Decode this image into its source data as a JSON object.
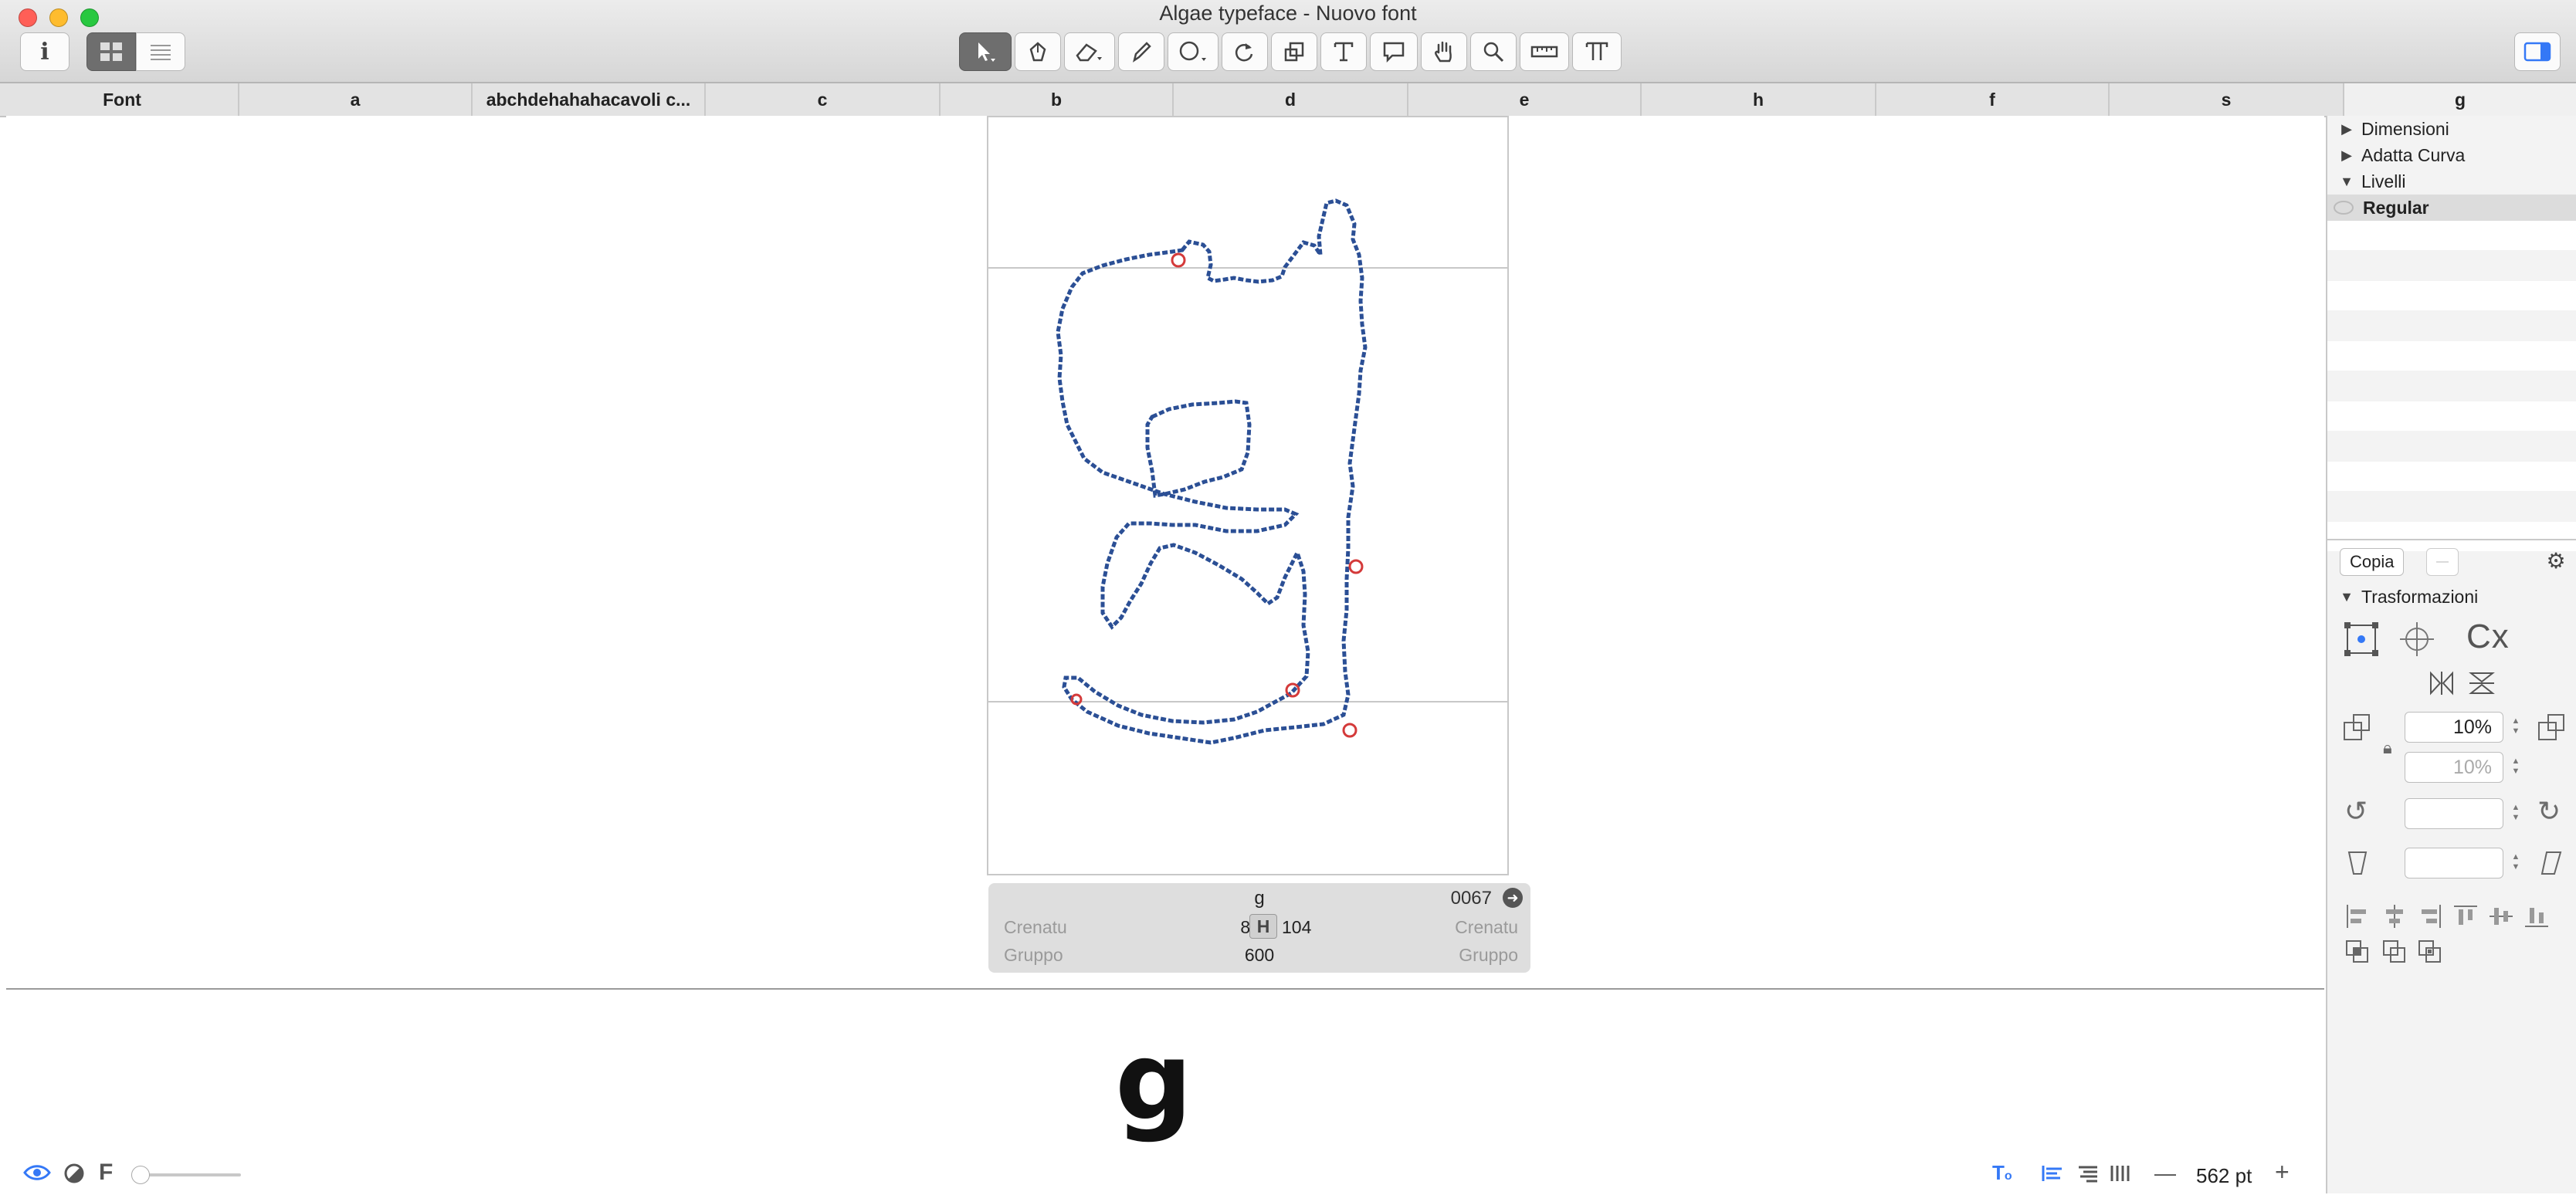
{
  "window": {
    "title": "Algae typeface - Nuovo font"
  },
  "toolbar": {
    "info_icon": "info-icon",
    "tools": [
      "select-tool",
      "pen-tool",
      "eraser-tool",
      "pencil-tool",
      "shape-tool",
      "rotate-tool",
      "scale-tool",
      "text-tool",
      "annotation-tool",
      "hand-tool",
      "zoom-tool",
      "measure-tool",
      "metrics-tool"
    ]
  },
  "tabs": [
    "Font",
    "a",
    "abchdehahahacavoli c...",
    "c",
    "b",
    "d",
    "e",
    "h",
    "f",
    "s",
    "g"
  ],
  "active_tab": "g",
  "glyph_info": {
    "name": "g",
    "unicode": "0067",
    "kerning_label": "Crenatu",
    "left_sidebearing": "85",
    "right_sidebearing": "104",
    "group_label": "Gruppo",
    "width": "600"
  },
  "sidebar": {
    "tree": [
      {
        "label": "Dimensioni",
        "expanded": false
      },
      {
        "label": "Adatta Curva",
        "expanded": false
      },
      {
        "label": "Livelli",
        "expanded": true
      },
      {
        "label": "Regular",
        "expanded": false
      }
    ],
    "copy_button": "Copia",
    "transform_section": "Trasformazioni",
    "scale_x": "10%",
    "scale_y": "10%",
    "align_label": "Cx"
  },
  "bottom_bar": {
    "zoom_value": "562 pt",
    "font_icon": "F"
  },
  "colors": {
    "outline": "#2b4f95",
    "node_red": "#d43a3a",
    "accent": "#3478f6"
  }
}
